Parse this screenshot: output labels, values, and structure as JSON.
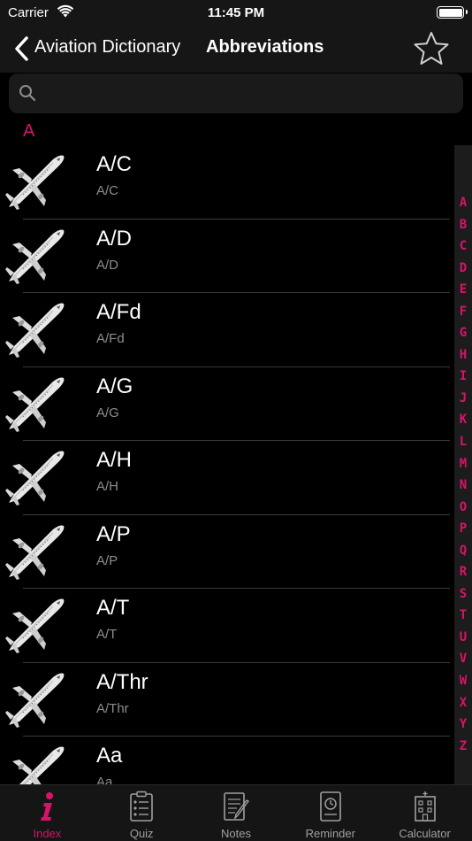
{
  "status": {
    "carrier": "Carrier",
    "time": "11:45 PM"
  },
  "nav": {
    "back_label": "Aviation Dictionary",
    "title": "Abbreviations"
  },
  "search": {
    "placeholder": "",
    "value": ""
  },
  "section_header": "A",
  "rows": [
    {
      "term": "A/C",
      "subtitle": "A/C"
    },
    {
      "term": "A/D",
      "subtitle": "A/D"
    },
    {
      "term": "A/Fd",
      "subtitle": "A/Fd"
    },
    {
      "term": "A/G",
      "subtitle": "A/G"
    },
    {
      "term": "A/H",
      "subtitle": "A/H"
    },
    {
      "term": "A/P",
      "subtitle": "A/P"
    },
    {
      "term": "A/T",
      "subtitle": "A/T"
    },
    {
      "term": "A/Thr",
      "subtitle": "A/Thr"
    },
    {
      "term": "Aa",
      "subtitle": "Aa"
    }
  ],
  "index_letters": [
    "A",
    "B",
    "C",
    "D",
    "E",
    "F",
    "G",
    "H",
    "I",
    "J",
    "K",
    "L",
    "M",
    "N",
    "O",
    "P",
    "Q",
    "R",
    "S",
    "T",
    "U",
    "V",
    "W",
    "X",
    "Y",
    "Z"
  ],
  "tabs": [
    {
      "label": "Index",
      "icon": "info-icon",
      "active": true
    },
    {
      "label": "Quiz",
      "icon": "clipboard-icon",
      "active": false
    },
    {
      "label": "Notes",
      "icon": "notes-icon",
      "active": false
    },
    {
      "label": "Reminder",
      "icon": "clock-icon",
      "active": false
    },
    {
      "label": "Calculator",
      "icon": "building-icon",
      "active": false
    }
  ],
  "colors": {
    "accent": "#d6146b",
    "background": "#000000",
    "bar": "#161616"
  }
}
